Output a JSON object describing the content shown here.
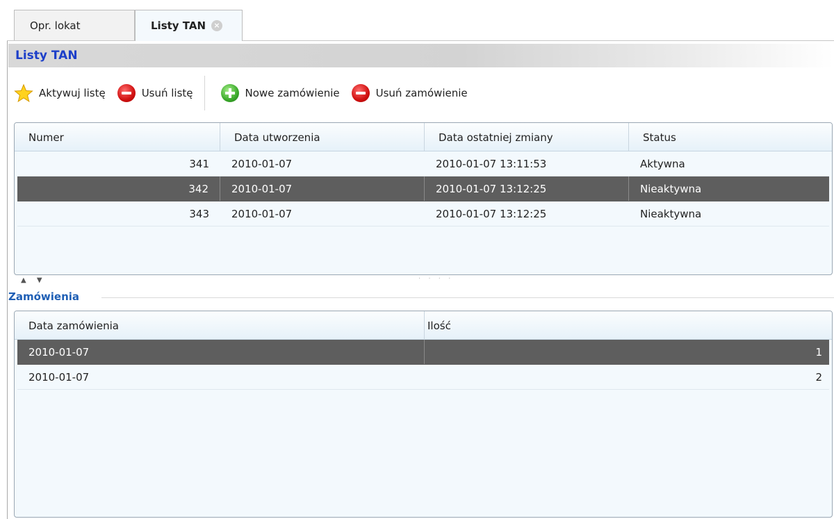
{
  "tabs": [
    {
      "label": "Opr. lokat"
    },
    {
      "label": "Listy TAN"
    }
  ],
  "panel": {
    "title": "Listy TAN"
  },
  "toolbar": {
    "activate_label": "Aktywuj listę",
    "delete_list_label": "Usuń listę",
    "new_order_label": "Nowe zamówienie",
    "delete_order_label": "Usuń zamówienie"
  },
  "lists_table": {
    "columns": [
      "Numer",
      "Data utworzenia",
      "Data ostatniej zmiany",
      "Status"
    ],
    "rows": [
      {
        "numer": "341",
        "data_utworzenia": "2010-01-07",
        "data_zmiany": "2010-01-07 13:11:53",
        "status": "Aktywna"
      },
      {
        "numer": "342",
        "data_utworzenia": "2010-01-07",
        "data_zmiany": "2010-01-07 13:12:25",
        "status": "Nieaktywna"
      },
      {
        "numer": "343",
        "data_utworzenia": "2010-01-07",
        "data_zmiany": "2010-01-07 13:12:25",
        "status": "Nieaktywna"
      }
    ],
    "selected_row": 1
  },
  "orders_section": {
    "title": "Zamówienia"
  },
  "orders_table": {
    "columns": [
      "Data zamówienia",
      "Ilość"
    ],
    "rows": [
      {
        "data": "2010-01-07",
        "ilosc": "1"
      },
      {
        "data": "2010-01-07",
        "ilosc": "2"
      }
    ],
    "selected_row": 0
  },
  "colors": {
    "title_blue": "#1d3fc9",
    "section_blue": "#1f5fb5",
    "selected_row": "#5e5e5e"
  }
}
